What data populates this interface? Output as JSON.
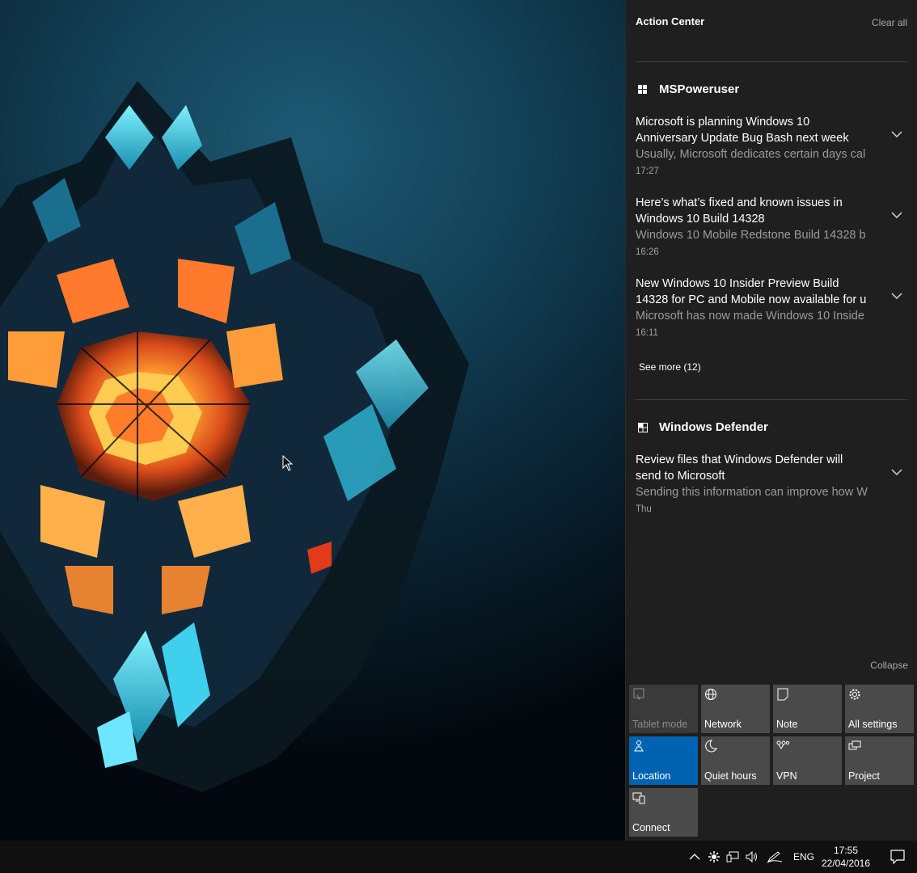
{
  "action_center": {
    "title": "Action Center",
    "clear_all": "Clear all",
    "collapse": "Collapse",
    "groups": [
      {
        "app": "MSPoweruser",
        "icon": "windows-logo-icon",
        "notifications": [
          {
            "title_line1": "Microsoft is planning Windows 10",
            "title_line2": "Anniversary Update Bug Bash next week",
            "body": "Usually, Microsoft dedicates certain days cal",
            "time": "17:27"
          },
          {
            "title_line1": "Here’s what’s fixed and known issues in",
            "title_line2": "Windows 10 Build 14328",
            "body": "Windows 10 Mobile Redstone Build 14328 b",
            "time": "16:26"
          },
          {
            "title_line1": "New Windows 10 Insider Preview Build",
            "title_line2": "14328 for PC and Mobile now available for u",
            "body": "Microsoft has now made Windows 10 Inside",
            "time": "16:11"
          }
        ],
        "see_more": "See more (12)"
      },
      {
        "app": "Windows Defender",
        "icon": "defender-icon",
        "notifications": [
          {
            "title_line1": "Review files that Windows Defender will",
            "title_line2": "send to Microsoft",
            "body": "Sending this information can improve how W",
            "time": "Thu"
          }
        ]
      }
    ],
    "quick_actions": [
      {
        "label": "Tablet mode",
        "icon": "tablet-mode-icon",
        "state": "disabled"
      },
      {
        "label": "Network",
        "icon": "globe-icon",
        "state": "off"
      },
      {
        "label": "Note",
        "icon": "note-icon",
        "state": "off"
      },
      {
        "label": "All settings",
        "icon": "gear-icon",
        "state": "off"
      },
      {
        "label": "Location",
        "icon": "location-icon",
        "state": "on"
      },
      {
        "label": "Quiet hours",
        "icon": "moon-icon",
        "state": "off"
      },
      {
        "label": "VPN",
        "icon": "vpn-icon",
        "state": "off"
      },
      {
        "label": "Project",
        "icon": "project-icon",
        "state": "off"
      },
      {
        "label": "Connect",
        "icon": "connect-icon",
        "state": "off"
      }
    ],
    "colors": {
      "panel": "#1f1f1f",
      "tile": "#4a4a4a",
      "tile_active": "#0063b1"
    }
  },
  "taskbar": {
    "language": "ENG",
    "time": "17:55",
    "date": "22/04/2016",
    "tray_icons": [
      "chevron-up-icon",
      "settings-sun-icon",
      "network-wired-icon",
      "volume-icon",
      "pen-icon"
    ]
  }
}
